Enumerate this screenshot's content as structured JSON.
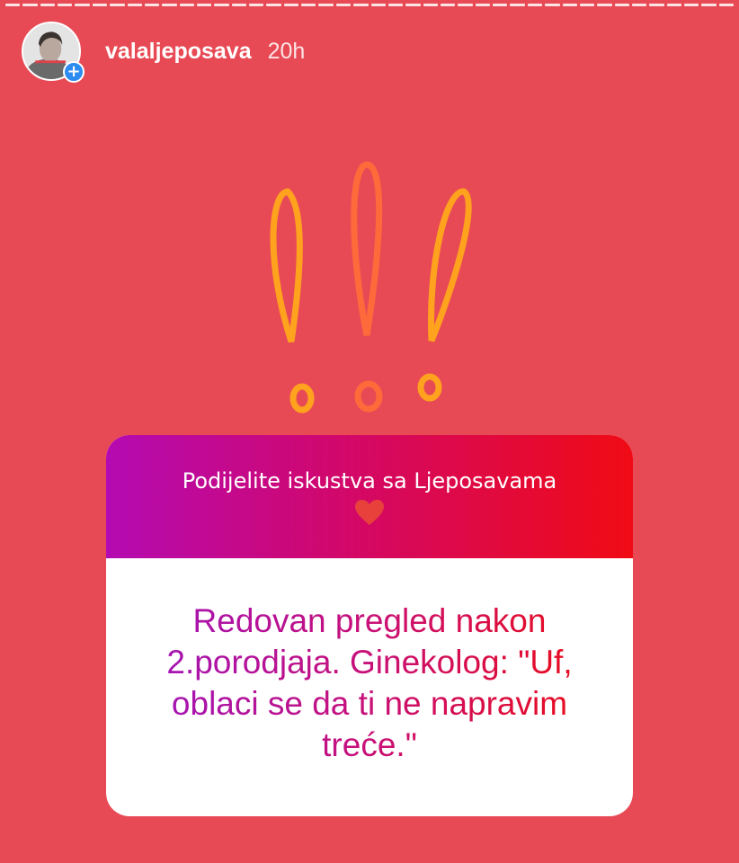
{
  "story": {
    "progress_segments": 42,
    "background_color": "#e84a55"
  },
  "header": {
    "avatar_icon": "profile-photo",
    "badge_icon": "plus-icon",
    "badge_symbol": "+",
    "username": "valaljeposava",
    "time": "20h"
  },
  "sticker": {
    "icon": "triple-exclamation-icon",
    "colors": [
      "#ffa21e",
      "#ff6a3a",
      "#ffa21e"
    ]
  },
  "question_card": {
    "title": "Podijelite iskustva sa Ljeposavama",
    "emoji": "heart-icon",
    "emoji_color": "#e8413c",
    "gradient": [
      "#b40ab2",
      "#f00b14"
    ],
    "answer": "Redovan pregled nakon 2.porodjaja. Ginekolog: \"Uf, oblaci se da ti ne napravim treće.\""
  }
}
